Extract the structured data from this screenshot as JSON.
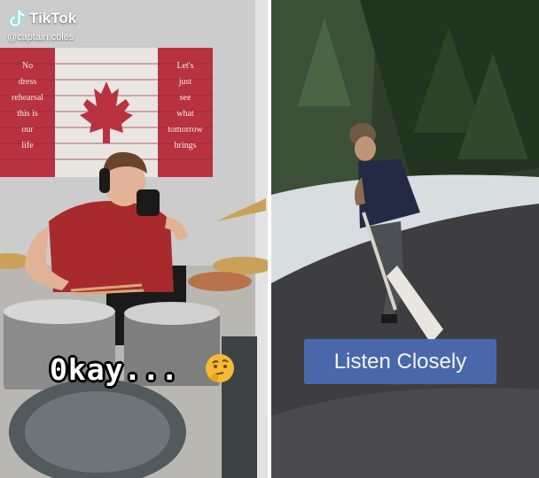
{
  "overlay": {
    "app_name": "TikTok",
    "handle": "@captain.coles",
    "left_caption": "0kay...",
    "right_caption": "Listen Closely"
  },
  "flag": {
    "left_lines": [
      "No",
      "dress",
      "rehearsal",
      "this is",
      "our",
      "life"
    ],
    "right_lines": [
      "Let's",
      "just",
      "see",
      "what",
      "tomorrow",
      "brings"
    ]
  },
  "colors": {
    "caption_bg": "#4a6bb1",
    "flag_red": "#b8323f",
    "wall": "#cfd0cf"
  },
  "icons": {
    "tiktok": "tiktok-logo-icon",
    "thinking": "thinking-face-emoji-icon"
  }
}
